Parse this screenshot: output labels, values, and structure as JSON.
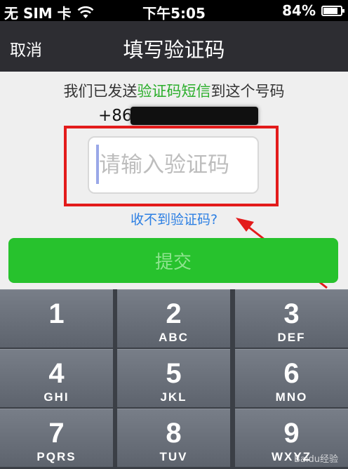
{
  "status_bar": {
    "carrier": "无 SIM 卡",
    "time": "下午5:05",
    "battery": "84%",
    "battery_level": 0.84,
    "wifi_icon": "wifi-icon",
    "battery_icon": "battery-icon"
  },
  "nav": {
    "cancel_label": "取消",
    "title": "填写验证码"
  },
  "info": {
    "prefix": "我们已发送",
    "highlight": "验证码短信",
    "suffix": "到这个号码",
    "highlight_color": "#2aae2a"
  },
  "phone": {
    "country_code": "+86"
  },
  "code_input": {
    "value": "",
    "placeholder": "请输入验证码"
  },
  "resend_link": "收不到验证码?",
  "submit_label": "提交",
  "accent_colors": {
    "submit": "#27c22d",
    "annotation": "#e31b1b",
    "link": "#2c7fe3"
  },
  "keypad": {
    "keys": [
      {
        "num": "1",
        "letters": ""
      },
      {
        "num": "2",
        "letters": "ABC"
      },
      {
        "num": "3",
        "letters": "DEF"
      },
      {
        "num": "4",
        "letters": "GHI"
      },
      {
        "num": "5",
        "letters": "JKL"
      },
      {
        "num": "6",
        "letters": "MNO"
      },
      {
        "num": "7",
        "letters": "PQRS"
      },
      {
        "num": "8",
        "letters": "TUV"
      },
      {
        "num": "9",
        "letters": "WXYZ"
      }
    ]
  },
  "watermark": "Baidu经验"
}
